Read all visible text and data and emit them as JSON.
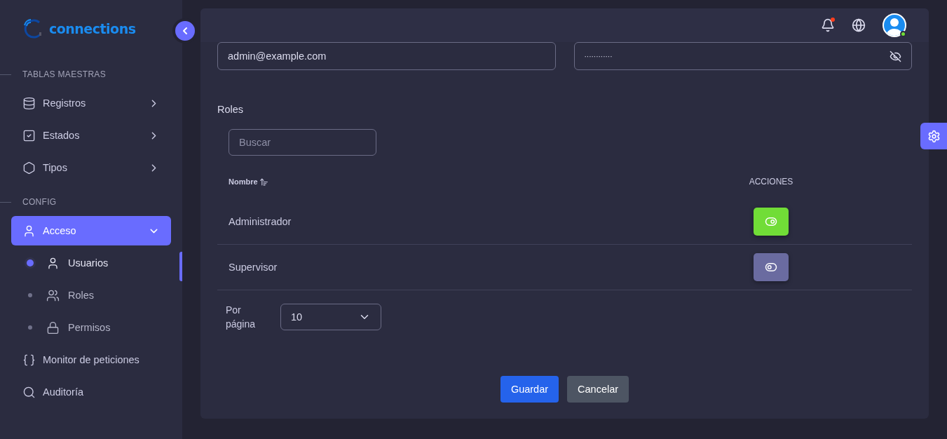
{
  "sidebar": {
    "logo": "connections",
    "sections": [
      {
        "title": "TABLAS MAESTRAS",
        "items": [
          {
            "label": "Registros",
            "expanded": false,
            "selected": false
          },
          {
            "label": "Estados",
            "expanded": false,
            "selected": false
          },
          {
            "label": "Tipos",
            "expanded": false,
            "selected": false
          }
        ]
      },
      {
        "title": "CONFIG",
        "items": [
          {
            "label": "Acceso",
            "expanded": true,
            "selected": true,
            "children": [
              {
                "label": "Usuarios",
                "selected": true
              },
              {
                "label": "Roles",
                "selected": false
              },
              {
                "label": "Permisos",
                "selected": false
              }
            ]
          },
          {
            "label": "Monitor de peticiones",
            "selected": false
          },
          {
            "label": "Auditoría",
            "selected": false
          }
        ]
      }
    ]
  },
  "header": {
    "notification": true,
    "online": true
  },
  "form": {
    "email": "admin@example.com",
    "password": "············",
    "roles": {
      "title": "Roles",
      "search": {
        "placeholder": "Buscar"
      },
      "columns": [
        "Nombre",
        "ACCIONES"
      ],
      "rows": [
        {
          "name": "Administrador",
          "on": true
        },
        {
          "name": "Supervisor",
          "on": false
        }
      ],
      "per_page_label": "Por página",
      "per_page": "10"
    },
    "buttons": [
      {
        "label": "Guardar",
        "kind": "primary"
      },
      {
        "label": "Cancelar",
        "kind": "secondary"
      }
    ]
  }
}
